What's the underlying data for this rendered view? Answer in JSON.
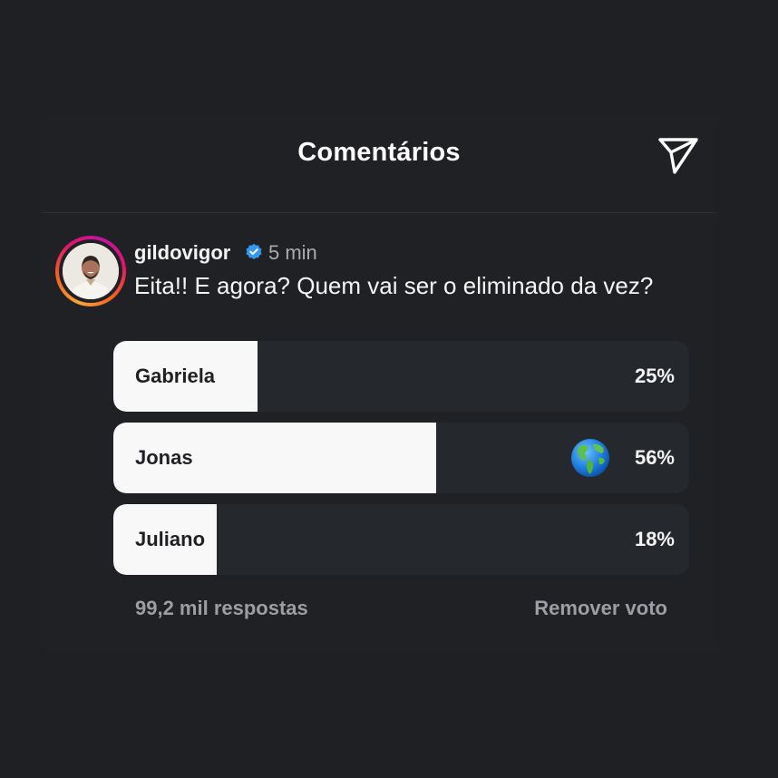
{
  "header": {
    "title": "Comentários",
    "share_icon": "send-icon"
  },
  "comment": {
    "username": "gildovigor",
    "verified_icon": "verified-badge-icon",
    "time": "5 min",
    "text": "Eita!! E agora? Quem vai ser o eliminado da vez?"
  },
  "poll": {
    "options": [
      {
        "label": "Gabriela",
        "percent": "25%",
        "fill_fraction": 0.25,
        "selected": false
      },
      {
        "label": "Jonas",
        "percent": "56%",
        "fill_fraction": 0.56,
        "selected": true,
        "vote_icon": "globe-emoji-icon"
      },
      {
        "label": "Juliano",
        "percent": "18%",
        "fill_fraction": 0.18,
        "selected": false
      }
    ],
    "responses": "99,2 mil respostas",
    "remove_vote": "Remover voto"
  },
  "colors": {
    "background": "#1f2024",
    "bar_fill": "#f8f8f8",
    "bar_track": "#25282d",
    "verified": "#3797f0",
    "muted_text": "#9b9ea4"
  }
}
